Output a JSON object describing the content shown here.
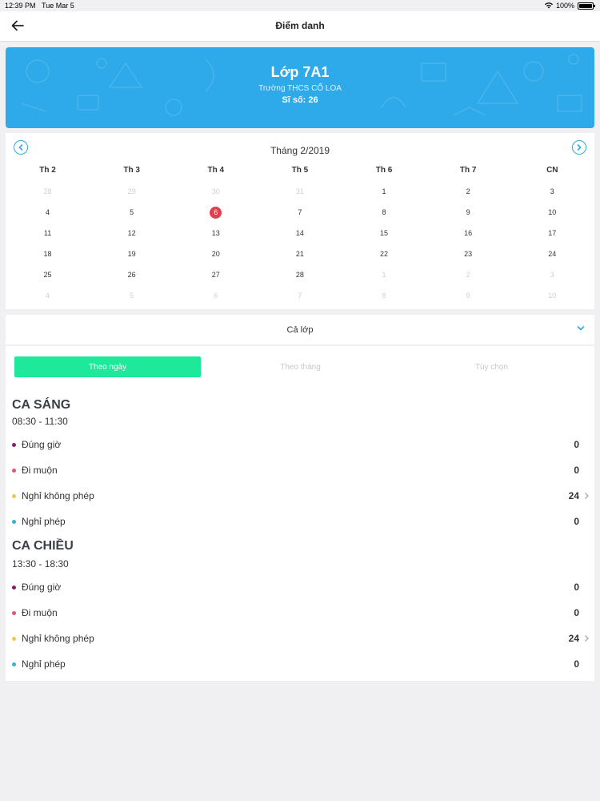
{
  "status": {
    "time": "12:39 PM",
    "date": "Tue Mar 5",
    "battery": "100%"
  },
  "nav": {
    "title": "Điểm danh"
  },
  "banner": {
    "class_name": "Lớp 7A1",
    "school": "Trường THCS CỔ LOA",
    "siso": "Sĩ số: 26",
    "color": "#2ea9ea"
  },
  "calendar": {
    "month": "Tháng 2/2019",
    "weekdays": [
      "Th 2",
      "Th 3",
      "Th 4",
      "Th 5",
      "Th 6",
      "Th 7",
      "CN"
    ],
    "days": [
      {
        "d": "28",
        "m": true
      },
      {
        "d": "29",
        "m": true
      },
      {
        "d": "30",
        "m": true
      },
      {
        "d": "31",
        "m": true
      },
      {
        "d": "1"
      },
      {
        "d": "2"
      },
      {
        "d": "3"
      },
      {
        "d": "4"
      },
      {
        "d": "5"
      },
      {
        "d": "6",
        "sel": true
      },
      {
        "d": "7"
      },
      {
        "d": "8"
      },
      {
        "d": "9"
      },
      {
        "d": "10"
      },
      {
        "d": "11"
      },
      {
        "d": "12"
      },
      {
        "d": "13"
      },
      {
        "d": "14"
      },
      {
        "d": "15"
      },
      {
        "d": "16"
      },
      {
        "d": "17"
      },
      {
        "d": "18"
      },
      {
        "d": "19"
      },
      {
        "d": "20"
      },
      {
        "d": "21"
      },
      {
        "d": "22"
      },
      {
        "d": "23"
      },
      {
        "d": "24"
      },
      {
        "d": "25"
      },
      {
        "d": "26"
      },
      {
        "d": "27"
      },
      {
        "d": "28"
      },
      {
        "d": "1",
        "m": true
      },
      {
        "d": "2",
        "m": true
      },
      {
        "d": "3",
        "m": true
      },
      {
        "d": "4",
        "m": true
      },
      {
        "d": "5",
        "m": true
      },
      {
        "d": "6",
        "m": true
      },
      {
        "d": "7",
        "m": true
      },
      {
        "d": "8",
        "m": true
      },
      {
        "d": "9",
        "m": true
      },
      {
        "d": "10",
        "m": true
      }
    ],
    "selected_color": "#e53e4c"
  },
  "filter": {
    "label": "Cả lớp"
  },
  "tabs": [
    {
      "label": "Theo ngày",
      "active": true
    },
    {
      "label": "Theo tháng"
    },
    {
      "label": "Tùy chọn"
    }
  ],
  "tab_active_color": "#1ee89a",
  "shifts": [
    {
      "title": "CA SÁNG",
      "time": "08:30 - 11:30",
      "rows": [
        {
          "label": "Đúng giờ",
          "count": "0",
          "color": "#8b1a6b"
        },
        {
          "label": "Đi muộn",
          "count": "0",
          "color": "#e8536a"
        },
        {
          "label": "Nghỉ không phép",
          "count": "24",
          "color": "#f5c542",
          "chevron": true
        },
        {
          "label": "Nghỉ phép",
          "count": "0",
          "color": "#2bb5d8"
        }
      ]
    },
    {
      "title": "CA CHIỀU",
      "time": "13:30 - 18:30",
      "rows": [
        {
          "label": "Đúng giờ",
          "count": "0",
          "color": "#8b1a6b"
        },
        {
          "label": "Đi muộn",
          "count": "0",
          "color": "#e8536a"
        },
        {
          "label": "Nghỉ không phép",
          "count": "24",
          "color": "#f5c542",
          "chevron": true
        },
        {
          "label": "Nghỉ phép",
          "count": "0",
          "color": "#2bb5d8"
        }
      ]
    }
  ]
}
